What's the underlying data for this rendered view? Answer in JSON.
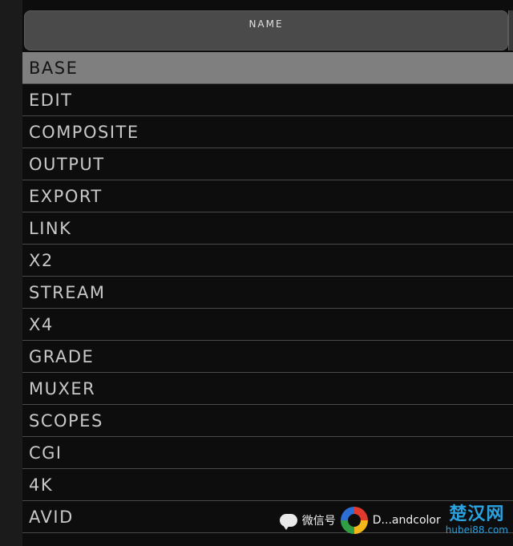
{
  "header": {
    "column_label": "NAME"
  },
  "list": {
    "selected_index": 0,
    "items": [
      "BASE",
      "EDIT",
      "COMPOSITE",
      "OUTPUT",
      "EXPORT",
      "LINK",
      "X2",
      "STREAM",
      "X4",
      "GRADE",
      "MUXER",
      "SCOPES",
      "CGI",
      "4K",
      "AVID"
    ]
  },
  "watermark": {
    "label": "微信号",
    "handle": "D...andcolor",
    "site_name": "楚汉网",
    "site_url": "hubei88.com"
  },
  "colors": {
    "panel_bg": "#0d0d0d",
    "header_bg": "#4a4a4a",
    "selected_row_bg": "#7f7f7f",
    "row_text": "#c8c8c8",
    "watermark_accent": "#2aa2e0"
  }
}
